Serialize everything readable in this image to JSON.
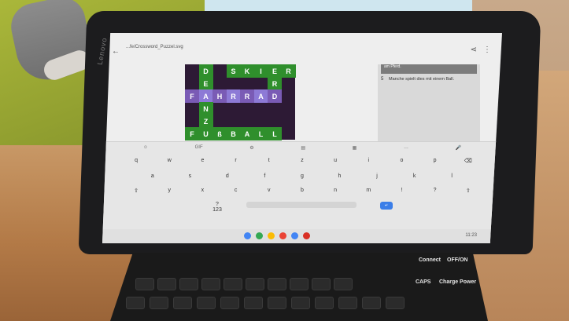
{
  "tablet": {
    "brand": "Lenovo"
  },
  "statusbar": {
    "time": "",
    "system": ""
  },
  "app": {
    "title": "...fe/Crossword_Puzzel.svg",
    "subtitle": "",
    "back_icon": "arrow-left-icon",
    "share_icon": "share-icon",
    "menu_icon": "more-vert-icon"
  },
  "crossword": {
    "rows": [
      [
        "",
        "D",
        "",
        "S",
        "K",
        "I",
        "E",
        "R"
      ],
      [
        "",
        "E",
        "",
        "",
        "",
        "",
        "R",
        ""
      ],
      [
        "F",
        "A",
        "H",
        "R",
        "R",
        "A",
        "D",
        ""
      ],
      [
        "",
        "N",
        "",
        "",
        "",
        "",
        "",
        ""
      ],
      [
        "",
        "Z",
        "",
        "",
        "",
        "",
        "",
        ""
      ],
      [
        "F",
        "U",
        "ß",
        "B",
        "A",
        "L",
        "L",
        ""
      ]
    ]
  },
  "clues": {
    "previous": "am Pferd.",
    "current_number": "5",
    "current_text": "Manche spielt dies mit einem Ball."
  },
  "keyboard": {
    "toolbar": [
      "☺",
      "GIF",
      "⚙",
      "▤",
      "▦",
      "…",
      "🎤"
    ],
    "row1": [
      "q",
      "w",
      "e",
      "r",
      "t",
      "z",
      "u",
      "i",
      "o",
      "p",
      "⌫"
    ],
    "row2": [
      "a",
      "s",
      "d",
      "f",
      "g",
      "h",
      "j",
      "k",
      "l"
    ],
    "row3": [
      "⇧",
      "y",
      "x",
      "c",
      "v",
      "b",
      "n",
      "m",
      "!",
      "?",
      "⇧"
    ],
    "enter_label": "↵",
    "num_label": "?123"
  },
  "nav": {
    "clock": "11:23"
  },
  "keyboard_case": {
    "connect": "Connect",
    "off_on": "OFF/ON",
    "caps": "CAPS",
    "charge": "Charge Power"
  }
}
